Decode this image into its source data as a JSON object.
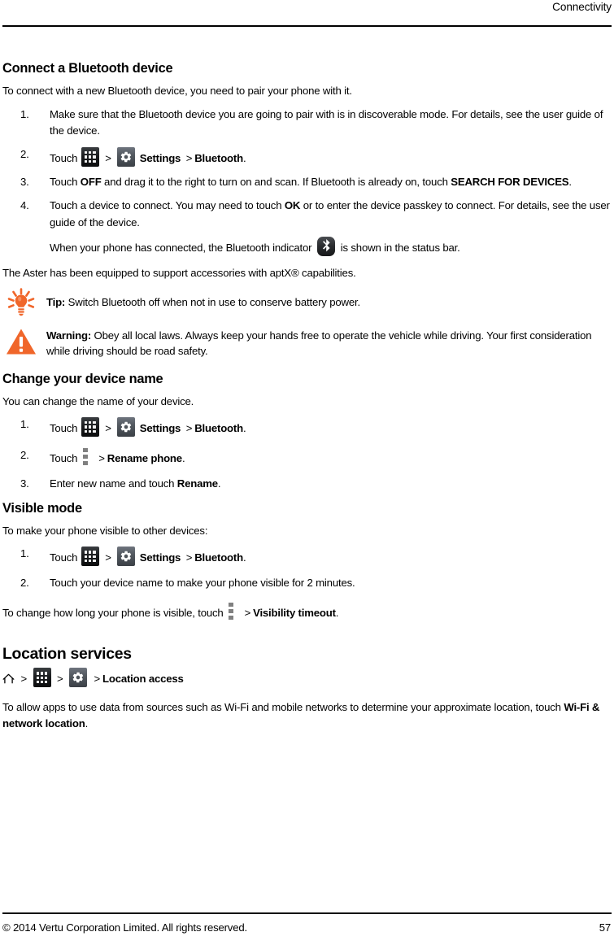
{
  "header": {
    "title": "Connectivity"
  },
  "sections": {
    "connect": {
      "heading": "Connect a Bluetooth device",
      "intro": "To connect with a new Bluetooth device, you need to pair your phone with it.",
      "steps": [
        {
          "num": "1.",
          "text": "Make sure that the Bluetooth device you are going to pair with is in discoverable mode. For details, see the user guide of the device."
        },
        {
          "num": "2.",
          "touch_label": "Touch",
          "settings_label": "Settings",
          "bluetooth_label": "Bluetooth",
          "period": "."
        },
        {
          "num": "3.",
          "lead": "Touch ",
          "off_label": "OFF",
          "mid": " and drag it to the right to turn on and scan. If Bluetooth is already on, touch ",
          "search_label": "SEARCH FOR DEVICES",
          "period": "."
        },
        {
          "num": "4.",
          "lead": "Touch a device to connect. You may need to touch ",
          "ok_label": "OK",
          "tail": " or to enter the device passkey to connect. For details, see the user guide of the device."
        }
      ],
      "indicator_note_before": "When your phone has connected, the Bluetooth indicator",
      "indicator_note_after": "is shown in the status bar.",
      "aptx_note": "The Aster has been equipped to support accessories with aptX® capabilities."
    },
    "tip": {
      "label": "Tip:",
      "text": " Switch Bluetooth off when not in use to conserve battery power."
    },
    "warning": {
      "label": "Warning:",
      "text": " Obey all local laws. Always keep your hands free to operate the vehicle while driving. Your first consideration while driving should be road safety."
    },
    "change_name": {
      "heading": "Change your device name",
      "intro": "You can change the name of your device.",
      "steps": [
        {
          "num": "1.",
          "touch_label": "Touch",
          "settings_label": "Settings",
          "bluetooth_label": "Bluetooth",
          "period": "."
        },
        {
          "num": "2.",
          "touch_label": "Touch",
          "rename_label": "Rename phone",
          "period": "."
        },
        {
          "num": "3.",
          "lead": "Enter new name and touch ",
          "rename_label": "Rename",
          "period": "."
        }
      ]
    },
    "visible_mode": {
      "heading": "Visible mode",
      "intro": "To make your phone visible to other devices:",
      "steps": [
        {
          "num": "1.",
          "touch_label": "Touch",
          "settings_label": "Settings",
          "bluetooth_label": "Bluetooth",
          "period": "."
        },
        {
          "num": "2.",
          "text": "Touch your device name to make your phone visible for 2 minutes."
        }
      ],
      "timeout_lead": "To change how long your phone is visible, touch",
      "timeout_label": "Visibility timeout",
      "timeout_period": "."
    },
    "location": {
      "heading": "Location services",
      "crumb_label": "Location access",
      "body_lead": "To allow apps to use data from sources such as Wi-Fi and mobile networks to determine your approximate location, touch ",
      "body_bold": "Wi-Fi & network location",
      "body_period": "."
    }
  },
  "footer": {
    "copyright": "© 2014 Vertu Corporation Limited. All rights reserved.",
    "page_number": "57"
  },
  "colors": {
    "accent_orange": "#F0662A",
    "text": "#000000",
    "icon_dark": "#17181A",
    "icon_gray_blue": "#52585F",
    "overflow_gray": "#808080"
  },
  "icons": {
    "app_drawer": "app-drawer-icon",
    "settings": "gear-icon",
    "bluetooth": "bluetooth-icon",
    "overflow": "overflow-menu-icon",
    "home": "home-icon",
    "tip": "lightbulb-icon",
    "warning": "warning-triangle-icon"
  },
  "separator": ">"
}
